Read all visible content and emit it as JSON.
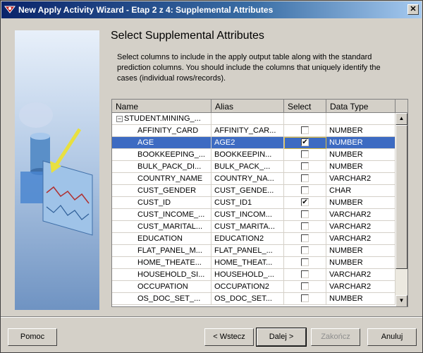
{
  "window": {
    "title": "New Apply Activity Wizard - Etap 2 z 4: Supplemental Attributes"
  },
  "heading": "Select Supplemental Attributes",
  "instructions": "Select columns to include in the apply output table along with the standard prediction columns. You should include the columns that uniquely identify the cases (individual rows/records).",
  "table": {
    "headers": {
      "name": "Name",
      "alias": "Alias",
      "select": "Select",
      "data_type": "Data Type"
    },
    "group": {
      "expander": "−",
      "label": "STUDENT.MINING_..."
    },
    "rows": [
      {
        "name": "AFFINITY_CARD",
        "alias": "AFFINITY_CAR...",
        "checkbox": "",
        "data_type": "NUMBER"
      },
      {
        "name": "AGE",
        "alias": "AGE2",
        "checkbox": "✔",
        "data_type": "NUMBER"
      },
      {
        "name": "BOOKKEEPING_...",
        "alias": "BOOKKEEPIN...",
        "checkbox": "",
        "data_type": "NUMBER"
      },
      {
        "name": "BULK_PACK_DI...",
        "alias": "BULK_PACK_...",
        "checkbox": "",
        "data_type": "NUMBER"
      },
      {
        "name": "COUNTRY_NAME",
        "alias": "COUNTRY_NA...",
        "checkbox": "",
        "data_type": "VARCHAR2"
      },
      {
        "name": "CUST_GENDER",
        "alias": "CUST_GENDE...",
        "checkbox": "",
        "data_type": "CHAR"
      },
      {
        "name": "CUST_ID",
        "alias": "CUST_ID1",
        "checkbox": "✔",
        "data_type": "NUMBER"
      },
      {
        "name": "CUST_INCOME_...",
        "alias": "CUST_INCOM...",
        "checkbox": "",
        "data_type": "VARCHAR2"
      },
      {
        "name": "CUST_MARITAL...",
        "alias": "CUST_MARITA...",
        "checkbox": "",
        "data_type": "VARCHAR2"
      },
      {
        "name": "EDUCATION",
        "alias": "EDUCATION2",
        "checkbox": "",
        "data_type": "VARCHAR2"
      },
      {
        "name": "FLAT_PANEL_M...",
        "alias": "FLAT_PANEL_...",
        "checkbox": "",
        "data_type": "NUMBER"
      },
      {
        "name": "HOME_THEATE...",
        "alias": "HOME_THEAT...",
        "checkbox": "",
        "data_type": "NUMBER"
      },
      {
        "name": "HOUSEHOLD_SI...",
        "alias": "HOUSEHOLD_...",
        "checkbox": "",
        "data_type": "VARCHAR2"
      },
      {
        "name": "OCCUPATION",
        "alias": "OCCUPATION2",
        "checkbox": "",
        "data_type": "VARCHAR2"
      },
      {
        "name": "OS_DOC_SET_...",
        "alias": "OS_DOC_SET...",
        "checkbox": "",
        "data_type": "NUMBER"
      }
    ],
    "selected_row": 1
  },
  "buttons": {
    "help": "Pomoc",
    "back": "< Wstecz",
    "next": "Dalej >",
    "finish": "Zakończ",
    "cancel": "Anuluj"
  },
  "colors": {
    "selection": "#3d6bc2",
    "titlebar": "#0a246a",
    "dialog": "#d4d0c8"
  },
  "icons": {
    "window": "wizard-app-icon",
    "close": "close-icon",
    "illustration": "database-mining-illustration"
  }
}
